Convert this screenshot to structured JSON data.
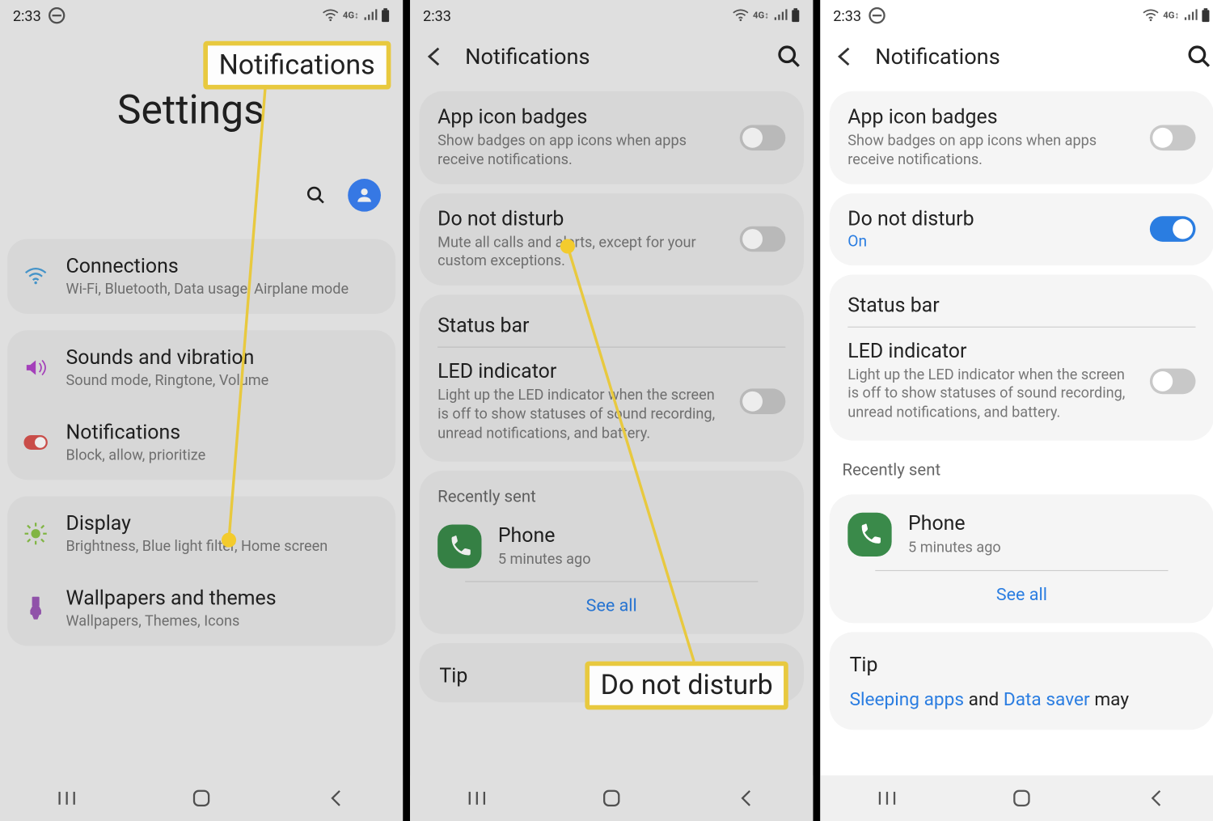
{
  "status": {
    "time": "2:33"
  },
  "callouts": {
    "notifications": "Notifications",
    "dnd": "Do not disturb"
  },
  "screen1": {
    "title": "Settings",
    "items": {
      "connections": {
        "title": "Connections",
        "sub": "Wi-Fi, Bluetooth, Data usage, Airplane mode"
      },
      "sounds": {
        "title": "Sounds and vibration",
        "sub": "Sound mode, Ringtone, Volume"
      },
      "notifications": {
        "title": "Notifications",
        "sub": "Block, allow, prioritize"
      },
      "display": {
        "title": "Display",
        "sub": "Brightness, Blue light filter, Home screen"
      },
      "wallpapers": {
        "title": "Wallpapers and themes",
        "sub": "Wallpapers, Themes, Icons"
      }
    }
  },
  "screen2": {
    "header": "Notifications",
    "badges": {
      "title": "App icon badges",
      "sub": "Show badges on app icons when apps receive notifications."
    },
    "dnd": {
      "title": "Do not disturb",
      "sub": "Mute all calls and alerts, except for your custom exceptions."
    },
    "statusbar": "Status bar",
    "led": {
      "title": "LED indicator",
      "sub": "Light up the LED indicator when the screen is off to show statuses of sound recording, unread notifications, and battery."
    },
    "recently": "Recently sent",
    "phone": {
      "title": "Phone",
      "sub": "5 minutes ago"
    },
    "seeall": "See all",
    "tip": "Tip"
  },
  "screen3": {
    "header": "Notifications",
    "badges": {
      "title": "App icon badges",
      "sub": "Show badges on app icons when apps receive notifications."
    },
    "dnd": {
      "title": "Do not disturb",
      "on": "On"
    },
    "statusbar": "Status bar",
    "led": {
      "title": "LED indicator",
      "sub": "Light up the LED indicator when the screen is off to show statuses of sound recording, unread notifications, and battery."
    },
    "recently": "Recently sent",
    "phone": {
      "title": "Phone",
      "sub": "5 minutes ago"
    },
    "seeall": "See all",
    "tip": "Tip",
    "tipbody": {
      "pre": "",
      "link1": "Sleeping apps",
      "mid": " and ",
      "link2": "Data saver",
      "post": " may"
    }
  }
}
